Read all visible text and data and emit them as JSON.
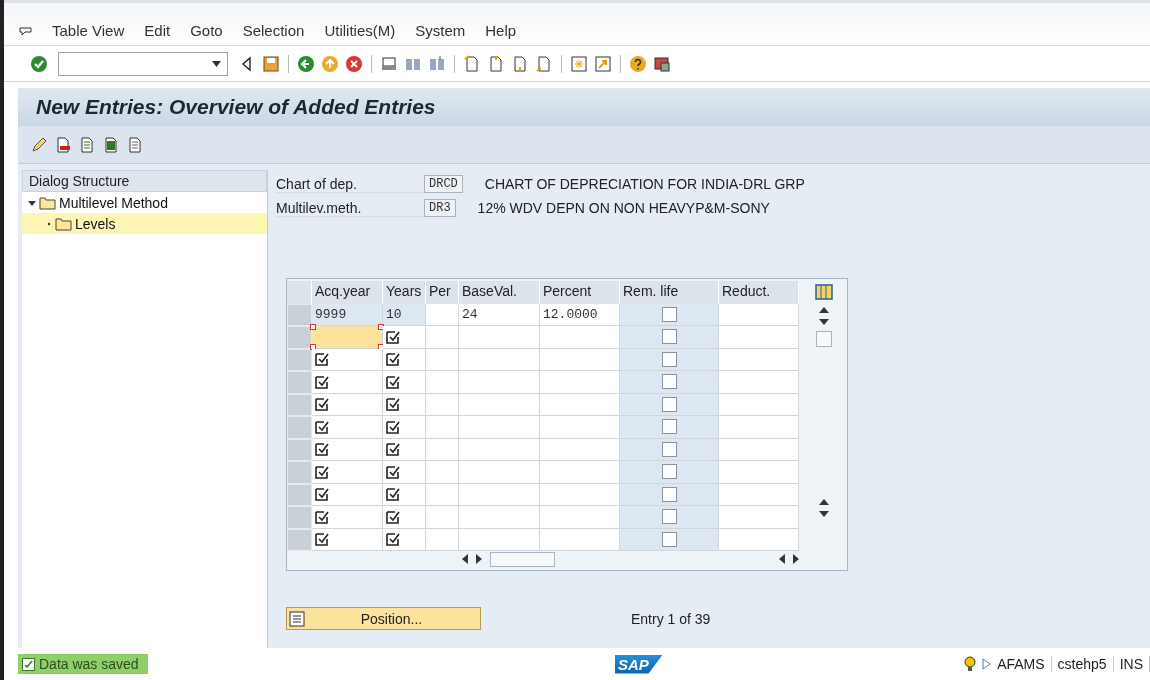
{
  "menu": [
    "Table View",
    "Edit",
    "Goto",
    "Selection",
    "Utilities(M)",
    "System",
    "Help"
  ],
  "title": "New Entries: Overview of Added Entries",
  "dialog_structure": {
    "title": "Dialog Structure",
    "items": [
      {
        "label": "Multilevel Method",
        "expanded": true,
        "selected": false,
        "children": [
          {
            "label": "Levels",
            "selected": true
          }
        ]
      }
    ]
  },
  "header_fields": [
    {
      "label": "Chart of dep.",
      "value": "DRCD",
      "description": "CHART OF DEPRECIATION FOR INDIA-DRL GRP"
    },
    {
      "label": "Multilev.meth.",
      "value": "DR3",
      "description": "12% WDV DEPN ON NON HEAVYP&M-SONY"
    }
  ],
  "table": {
    "columns": [
      "Acq.year",
      "Years",
      "Per",
      "BaseVal.",
      "Percent",
      "Rem. life",
      "Reduct."
    ],
    "rows": [
      {
        "kind": "entry",
        "focused": false,
        "acq_year": "9999",
        "years": "10",
        "base_val": "24",
        "percent": "12.0000",
        "rem_life": false
      },
      {
        "kind": "blank",
        "focused": true,
        "rem_life": false
      },
      {
        "kind": "blank",
        "focused": false,
        "rem_life": false
      },
      {
        "kind": "blank",
        "focused": false,
        "rem_life": false
      },
      {
        "kind": "blank",
        "focused": false,
        "rem_life": false
      },
      {
        "kind": "blank",
        "focused": false,
        "rem_life": false
      },
      {
        "kind": "blank",
        "focused": false,
        "rem_life": false
      },
      {
        "kind": "blank",
        "focused": false,
        "rem_life": false
      },
      {
        "kind": "blank",
        "focused": false,
        "rem_life": false
      },
      {
        "kind": "blank",
        "focused": false,
        "rem_life": false
      },
      {
        "kind": "blank",
        "focused": false,
        "rem_life": false
      }
    ]
  },
  "position_button": "Position...",
  "entry_count": "Entry 1 of 39",
  "status": {
    "message": "Data was saved",
    "kind": "success"
  },
  "logo": "SAP",
  "system_info": [
    "AFAMS",
    "cstehp5",
    "INS"
  ]
}
